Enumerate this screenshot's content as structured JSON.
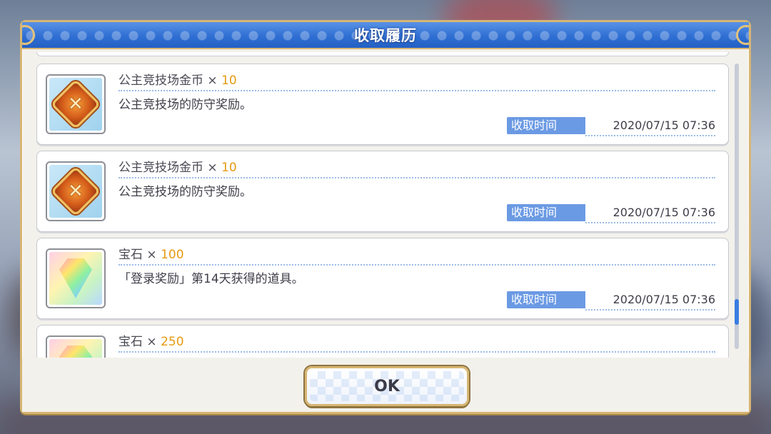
{
  "dialog": {
    "title": "收取履历",
    "ok_label": "OK"
  },
  "entries": [
    {
      "icon": "arena-coin-icon",
      "name": "公主竞技场金币",
      "multiplier": "×",
      "quantity": "10",
      "description": "公主竞技场的防守奖励。",
      "time_label": "收取时间",
      "time_value": "2020/07/15 07:36"
    },
    {
      "icon": "arena-coin-icon",
      "name": "公主竞技场金币",
      "multiplier": "×",
      "quantity": "10",
      "description": "公主竞技场的防守奖励。",
      "time_label": "收取时间",
      "time_value": "2020/07/15 07:36"
    },
    {
      "icon": "gem-icon",
      "name": "宝石",
      "multiplier": "×",
      "quantity": "100",
      "description": "「登录奖励」第14天获得的道具。",
      "time_label": "收取时间",
      "time_value": "2020/07/15 07:36"
    },
    {
      "icon": "gem-icon",
      "name": "宝石",
      "multiplier": "×",
      "quantity": "250",
      "description": "",
      "time_label": "",
      "time_value": ""
    }
  ],
  "colors": {
    "title_bar": "#2f6fd3",
    "quantity": "#e59a12",
    "time_label_bg": "#6b9ae4",
    "frame_gold": "#d7b673"
  }
}
